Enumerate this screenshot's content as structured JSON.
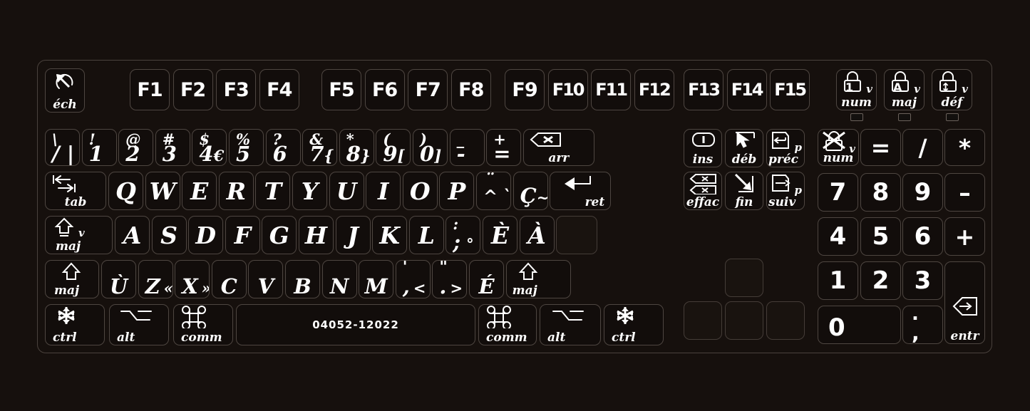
{
  "device": {
    "type": "keyboard-overlay",
    "layout_name": "Canadian French",
    "background_color": "#16100d",
    "key_color": "#120d0b",
    "legend_color": "#ffffff",
    "border_color": "#4e4641"
  },
  "spacebar": {
    "label": "04052-12022"
  },
  "function_row": {
    "escape": {
      "label": "éch",
      "icon": "escape-circle-arrow-icon"
    },
    "groups": [
      [
        "F1",
        "F2",
        "F3",
        "F4"
      ],
      [
        "F5",
        "F6",
        "F7",
        "F8"
      ],
      [
        "F9",
        "F10",
        "F11",
        "F12"
      ],
      [
        "F13",
        "F14",
        "F15"
      ]
    ],
    "locks": [
      {
        "icon": "padlock-num-icon",
        "glyph": "1",
        "sub": "v",
        "label": "num"
      },
      {
        "icon": "padlock-caps-icon",
        "glyph": "A",
        "sub": "v",
        "label": "maj"
      },
      {
        "icon": "padlock-scroll-icon",
        "glyph": "↕",
        "sub": "v",
        "label": "déf"
      }
    ]
  },
  "number_row": [
    {
      "upper": "\\",
      "lower": "/ |"
    },
    {
      "upper": "!",
      "lower": "1"
    },
    {
      "upper": "@",
      "lower": "2"
    },
    {
      "upper": "#",
      "lower": "3"
    },
    {
      "upper": "$",
      "lower": "4",
      "extra": "€"
    },
    {
      "upper": "%",
      "lower": "5"
    },
    {
      "upper": "?",
      "lower": "6"
    },
    {
      "upper": "&",
      "lower": "7",
      "extra": "{"
    },
    {
      "upper": "*",
      "lower": "8",
      "extra": "}"
    },
    {
      "upper": "(",
      "lower": "9",
      "extra": "["
    },
    {
      "upper": ")",
      "lower": "0",
      "extra": "]"
    },
    {
      "upper": "_",
      "lower": "-"
    },
    {
      "upper": "+",
      "lower": "="
    }
  ],
  "backspace": {
    "label": "arr",
    "icon": "backspace-x-arrow-icon"
  },
  "row_qwerty": {
    "tab": {
      "label": "tab",
      "icon": "tab-double-arrow-icon"
    },
    "keys": [
      "Q",
      "W",
      "E",
      "R",
      "T",
      "Y",
      "U",
      "I",
      "O",
      "P"
    ],
    "dead_key": {
      "upper": "¨",
      "lower": "^",
      "extra": "`"
    },
    "cedilla": {
      "lower": "Ç",
      "extra": "~"
    },
    "return": {
      "label": "ret",
      "icon": "return-arrow-icon"
    }
  },
  "row_home": {
    "caps": {
      "label": "maj",
      "sub": "v",
      "icon": "capslock-arrow-icon"
    },
    "keys": [
      "A",
      "S",
      "D",
      "F",
      "G",
      "H",
      "J",
      "K",
      "L"
    ],
    "semicolon": {
      "upper": ":",
      "lower": ";",
      "extra": "°"
    },
    "accents": [
      "È",
      "À"
    ]
  },
  "row_shift": {
    "shift_left": {
      "label": "maj",
      "icon": "shift-arrow-icon"
    },
    "keys": [
      {
        "lower": "Ù"
      },
      {
        "lower": "Z",
        "extra": "«"
      },
      {
        "lower": "X",
        "extra": "»"
      },
      {
        "lower": "C"
      },
      {
        "lower": "V"
      },
      {
        "lower": "B"
      },
      {
        "lower": "N"
      },
      {
        "lower": "M"
      },
      {
        "upper": "'",
        "lower": ",",
        "extra": "<"
      },
      {
        "upper": "\"",
        "lower": ".",
        "extra": ">"
      },
      {
        "lower": "É"
      }
    ],
    "shift_right": {
      "label": "maj",
      "icon": "shift-arrow-icon"
    }
  },
  "row_bottom": {
    "left": [
      {
        "label": "ctrl",
        "icon": "control-asterisk-icon"
      },
      {
        "label": "alt",
        "icon": "option-alt-icon"
      },
      {
        "label": "comm",
        "icon": "command-icon"
      }
    ],
    "right": [
      {
        "label": "comm",
        "icon": "command-icon"
      },
      {
        "label": "alt",
        "icon": "option-alt-icon"
      },
      {
        "label": "ctrl",
        "icon": "control-asterisk-icon"
      }
    ]
  },
  "nav_cluster": [
    {
      "label": "ins",
      "icon": "insert-i-icon"
    },
    {
      "label": "déb",
      "icon": "home-arrow-cursor-icon"
    },
    {
      "label": "p préc",
      "icon": "page-up-icon"
    },
    {
      "label": "effac",
      "icon": "delete-double-x-icon"
    },
    {
      "label": "fin",
      "icon": "end-arrow-icon"
    },
    {
      "label": "p suiv",
      "icon": "page-down-icon"
    }
  ],
  "numpad": {
    "top": [
      {
        "label": "num",
        "sub": "v",
        "icon": "clear-crossed-lock-icon"
      },
      {
        "glyph": "="
      },
      {
        "glyph": "/"
      },
      {
        "glyph": "*"
      }
    ],
    "digits": [
      [
        "7",
        "8",
        "9"
      ],
      [
        "4",
        "5",
        "6"
      ],
      [
        "1",
        "2",
        "3"
      ]
    ],
    "minus": "–",
    "plus": "+",
    "zero": "0",
    "decimal": {
      "upper": ".",
      "lower": ","
    },
    "enter": {
      "label": "entr",
      "icon": "enter-arrow-icon"
    }
  },
  "arrow_cluster": {
    "up": "",
    "left": "",
    "down": "",
    "right": ""
  }
}
